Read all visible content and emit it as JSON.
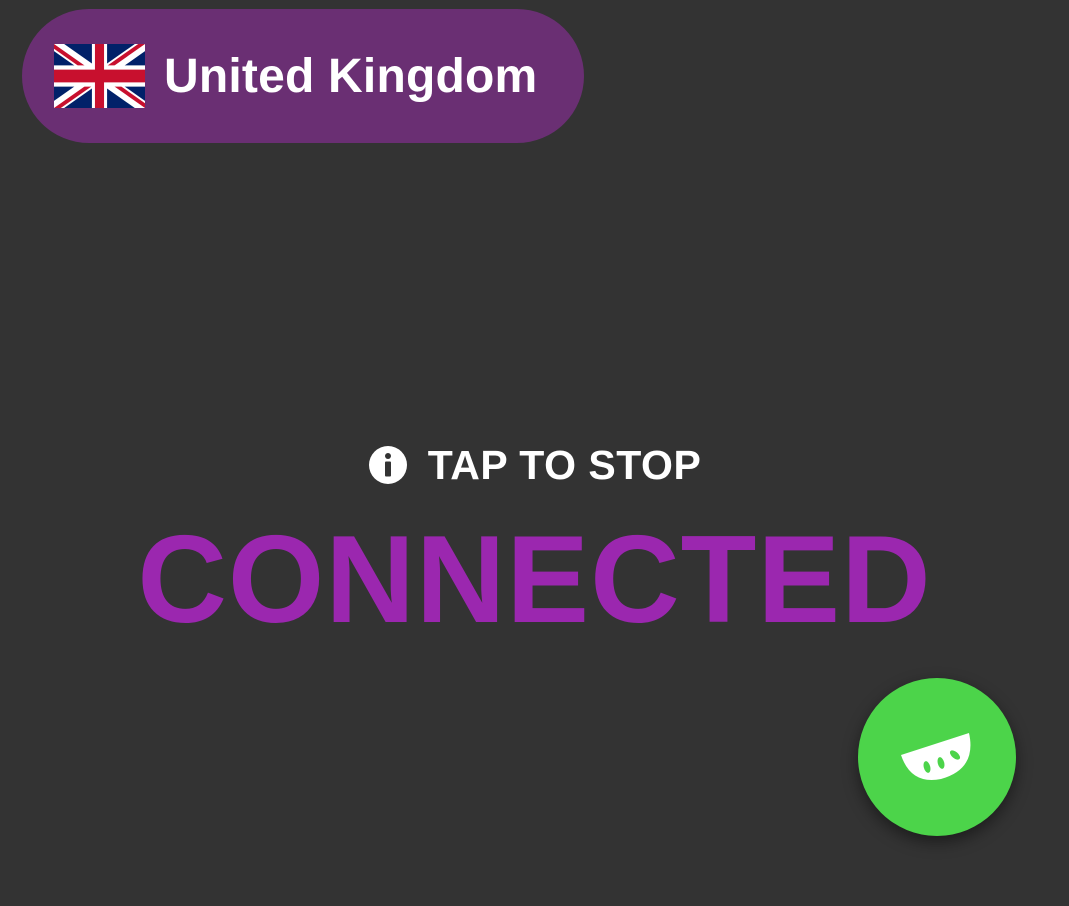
{
  "location": {
    "country_name": "United Kingdom",
    "flag_icon": "uk-flag-icon",
    "pill_color": "#6a2f73"
  },
  "status": {
    "hint_icon": "info-icon",
    "hint_text": "TAP TO STOP",
    "state_text": "CONNECTED",
    "state_color": "#9b27af"
  },
  "fab": {
    "icon": "lime-slice-icon",
    "color": "#4cd44a"
  },
  "theme": {
    "background": "#333333"
  }
}
